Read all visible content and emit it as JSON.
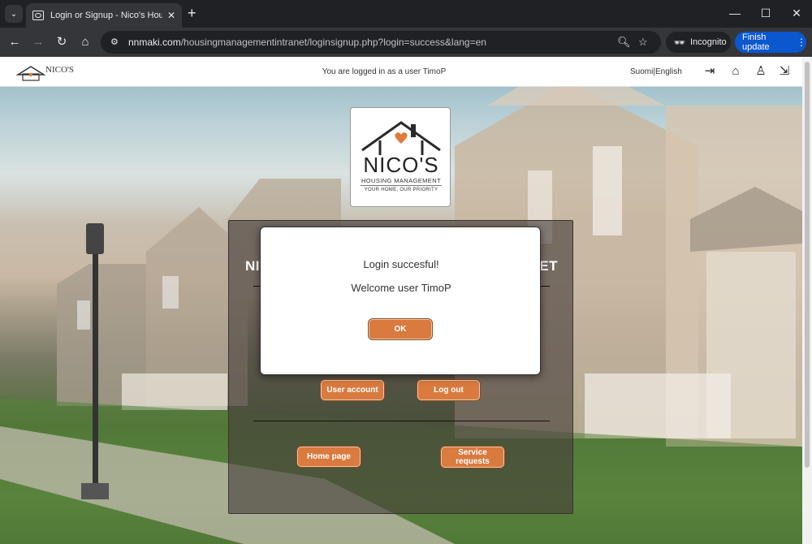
{
  "browser": {
    "tab_title": "Login or Signup - Nico's Housin",
    "url_domain": "nnmaki.com",
    "url_path": "/housingmanagementintranet/loginsignup.php?login=success&lang=en",
    "incognito_label": "Incognito",
    "update_label": "Finish update"
  },
  "header": {
    "logo_text": "NICO'S",
    "logged_in_message": "You are logged in as a user TimoP",
    "lang_fi": "Suomi",
    "lang_sep": "|",
    "lang_en": "English"
  },
  "logo": {
    "name": "NICO'S",
    "subtitle": "HOUSING MANAGEMENT",
    "tagline": "YOUR HOME, OUR PRIORITY",
    "accent_color": "#e07b3c"
  },
  "panel": {
    "title_left": "NI",
    "title_right": "ET",
    "user_account_label": "User account",
    "logout_label": "Log out",
    "home_label": "Home page",
    "service_requests_label": "Service requests"
  },
  "dialog": {
    "line1": "Login succesful!",
    "line2": "Welcome user TimoP",
    "ok_label": "OK"
  }
}
